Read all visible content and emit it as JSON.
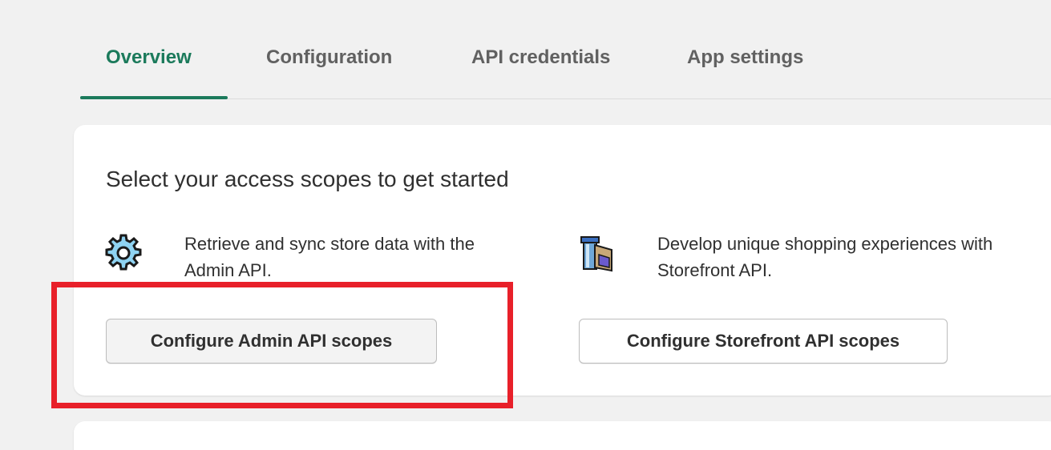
{
  "tabs": [
    {
      "label": "Overview",
      "active": true
    },
    {
      "label": "Configuration",
      "active": false
    },
    {
      "label": "API credentials",
      "active": false
    },
    {
      "label": "App settings",
      "active": false
    }
  ],
  "access_scopes": {
    "title": "Select your access scopes to get started",
    "admin": {
      "icon": "gear-icon",
      "description": "Retrieve and sync store data with the Admin API.",
      "button_label": "Configure Admin API scopes"
    },
    "storefront": {
      "icon": "storefront-icon",
      "description": "Develop unique shopping experiences with Storefront API.",
      "button_label": "Configure Storefront API scopes"
    }
  },
  "colors": {
    "accent": "#1b7a5b",
    "highlight": "#e8202a",
    "background": "#f1f1f1"
  }
}
